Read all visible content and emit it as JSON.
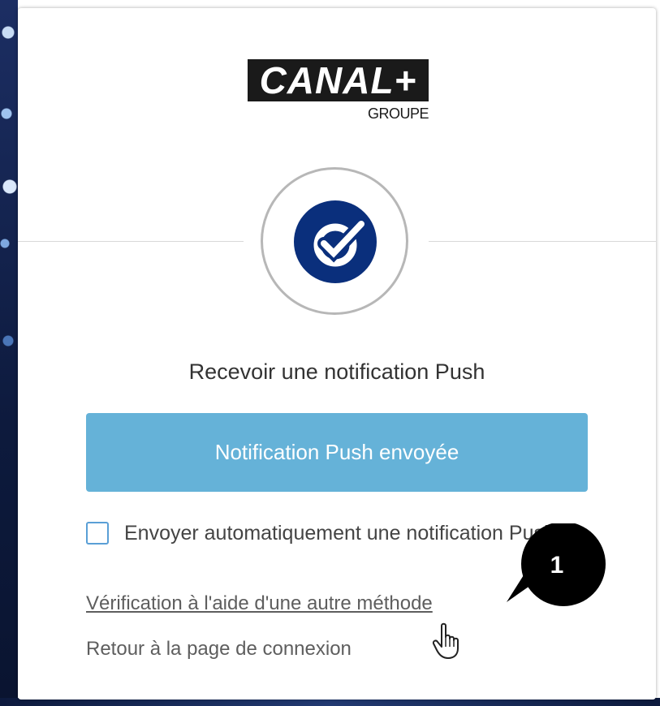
{
  "logo": {
    "main": "CANAL+",
    "sub": "GROUPE"
  },
  "factor": {
    "icon": "okta-verify-check-icon",
    "color": "#0a2f7c"
  },
  "title": "Recevoir une notification Push",
  "push_button": {
    "label": "Notification Push envoyée",
    "color": "#65b2d8"
  },
  "auto_push": {
    "label": "Envoyer automatiquement une notification Push",
    "checked": false
  },
  "links": {
    "other_method": "Vérification à l'aide d'une autre méthode",
    "back_to_login": "Retour à la page de connexion"
  },
  "annotation": {
    "number": "1"
  }
}
